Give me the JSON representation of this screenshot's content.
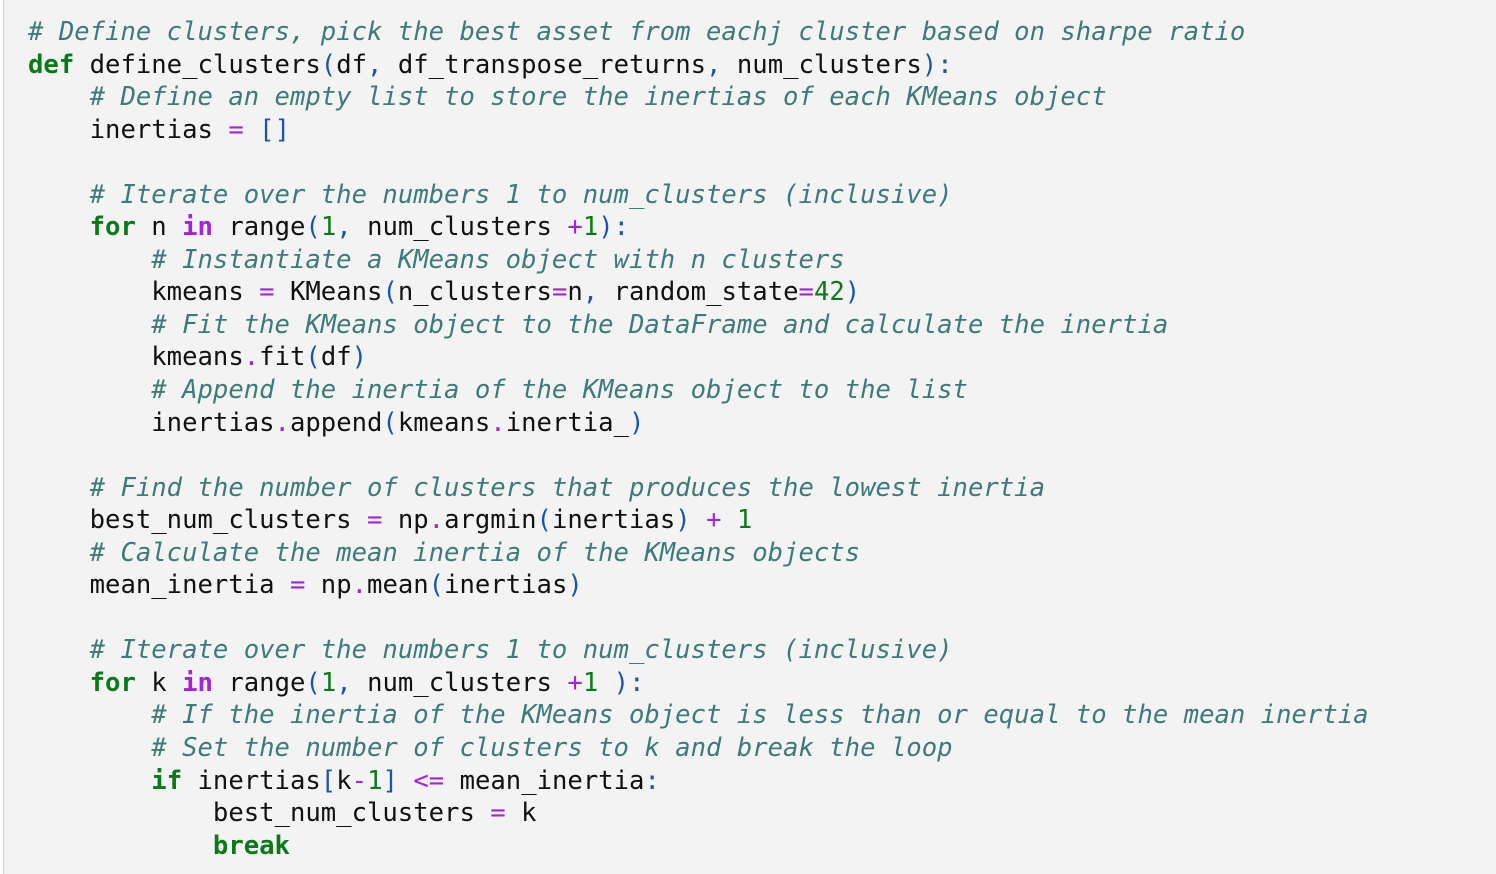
{
  "code_cell": {
    "language": "python",
    "colors": {
      "background": "#f3f3f3",
      "comment": "#3d7a7a",
      "keyword": "#0a7a18",
      "operator": "#a323d6",
      "punctuation": "#1a55a8",
      "number": "#0a7a18",
      "text": "#111111"
    },
    "lines": [
      [
        [
          "comment",
          "# Define clusters, pick the best asset from eachj cluster based on sharpe ratio"
        ]
      ],
      [
        [
          "keyword",
          "def"
        ],
        [
          "name",
          " define_clusters"
        ],
        [
          "punc",
          "("
        ],
        [
          "name",
          "df"
        ],
        [
          "punc",
          ","
        ],
        [
          "name",
          " df_transpose_returns"
        ],
        [
          "punc",
          ","
        ],
        [
          "name",
          " num_clusters"
        ],
        [
          "punc",
          "):"
        ]
      ],
      [
        [
          "name",
          "    "
        ],
        [
          "comment",
          "# Define an empty list to store the inertias of each KMeans object"
        ]
      ],
      [
        [
          "name",
          "    inertias "
        ],
        [
          "op",
          "="
        ],
        [
          "name",
          " "
        ],
        [
          "punc",
          "[]"
        ]
      ],
      [],
      [
        [
          "name",
          "    "
        ],
        [
          "comment",
          "# Iterate over the numbers 1 to num_clusters (inclusive)"
        ]
      ],
      [
        [
          "name",
          "    "
        ],
        [
          "keyword",
          "for"
        ],
        [
          "name",
          " n "
        ],
        [
          "kwop",
          "in"
        ],
        [
          "name",
          " range"
        ],
        [
          "punc",
          "("
        ],
        [
          "num",
          "1"
        ],
        [
          "punc",
          ","
        ],
        [
          "name",
          " num_clusters "
        ],
        [
          "op",
          "+"
        ],
        [
          "num",
          "1"
        ],
        [
          "punc",
          "):"
        ]
      ],
      [
        [
          "name",
          "        "
        ],
        [
          "comment",
          "# Instantiate a KMeans object with n clusters"
        ]
      ],
      [
        [
          "name",
          "        kmeans "
        ],
        [
          "op",
          "="
        ],
        [
          "name",
          " KMeans"
        ],
        [
          "punc",
          "("
        ],
        [
          "name",
          "n_clusters"
        ],
        [
          "op",
          "="
        ],
        [
          "name",
          "n"
        ],
        [
          "punc",
          ","
        ],
        [
          "name",
          " random_state"
        ],
        [
          "op",
          "="
        ],
        [
          "num",
          "42"
        ],
        [
          "punc",
          ")"
        ]
      ],
      [
        [
          "name",
          "        "
        ],
        [
          "comment",
          "# Fit the KMeans object to the DataFrame and calculate the inertia"
        ]
      ],
      [
        [
          "name",
          "        kmeans"
        ],
        [
          "op",
          "."
        ],
        [
          "name",
          "fit"
        ],
        [
          "punc",
          "("
        ],
        [
          "name",
          "df"
        ],
        [
          "punc",
          ")"
        ]
      ],
      [
        [
          "name",
          "        "
        ],
        [
          "comment",
          "# Append the inertia of the KMeans object to the list"
        ]
      ],
      [
        [
          "name",
          "        inertias"
        ],
        [
          "op",
          "."
        ],
        [
          "name",
          "append"
        ],
        [
          "punc",
          "("
        ],
        [
          "name",
          "kmeans"
        ],
        [
          "op",
          "."
        ],
        [
          "name",
          "inertia_"
        ],
        [
          "punc",
          ")"
        ]
      ],
      [],
      [
        [
          "name",
          "    "
        ],
        [
          "comment",
          "# Find the number of clusters that produces the lowest inertia"
        ]
      ],
      [
        [
          "name",
          "    best_num_clusters "
        ],
        [
          "op",
          "="
        ],
        [
          "name",
          " np"
        ],
        [
          "op",
          "."
        ],
        [
          "name",
          "argmin"
        ],
        [
          "punc",
          "("
        ],
        [
          "name",
          "inertias"
        ],
        [
          "punc",
          ")"
        ],
        [
          "name",
          " "
        ],
        [
          "op",
          "+"
        ],
        [
          "name",
          " "
        ],
        [
          "num",
          "1"
        ]
      ],
      [
        [
          "name",
          "    "
        ],
        [
          "comment",
          "# Calculate the mean inertia of the KMeans objects"
        ]
      ],
      [
        [
          "name",
          "    mean_inertia "
        ],
        [
          "op",
          "="
        ],
        [
          "name",
          " np"
        ],
        [
          "op",
          "."
        ],
        [
          "name",
          "mean"
        ],
        [
          "punc",
          "("
        ],
        [
          "name",
          "inertias"
        ],
        [
          "punc",
          ")"
        ]
      ],
      [],
      [
        [
          "name",
          "    "
        ],
        [
          "comment",
          "# Iterate over the numbers 1 to num_clusters (inclusive)"
        ]
      ],
      [
        [
          "name",
          "    "
        ],
        [
          "keyword",
          "for"
        ],
        [
          "name",
          " k "
        ],
        [
          "kwop",
          "in"
        ],
        [
          "name",
          " range"
        ],
        [
          "punc",
          "("
        ],
        [
          "num",
          "1"
        ],
        [
          "punc",
          ","
        ],
        [
          "name",
          " num_clusters "
        ],
        [
          "op",
          "+"
        ],
        [
          "num",
          "1"
        ],
        [
          "name",
          " "
        ],
        [
          "punc",
          "):"
        ]
      ],
      [
        [
          "name",
          "        "
        ],
        [
          "comment",
          "# If the inertia of the KMeans object is less than or equal to the mean inertia"
        ]
      ],
      [
        [
          "name",
          "        "
        ],
        [
          "comment",
          "# Set the number of clusters to k and break the loop"
        ]
      ],
      [
        [
          "name",
          "        "
        ],
        [
          "keyword",
          "if"
        ],
        [
          "name",
          " inertias"
        ],
        [
          "punc",
          "["
        ],
        [
          "name",
          "k"
        ],
        [
          "op",
          "-"
        ],
        [
          "num",
          "1"
        ],
        [
          "punc",
          "]"
        ],
        [
          "name",
          " "
        ],
        [
          "op",
          "<="
        ],
        [
          "name",
          " mean_inertia"
        ],
        [
          "punc",
          ":"
        ]
      ],
      [
        [
          "name",
          "            best_num_clusters "
        ],
        [
          "op",
          "="
        ],
        [
          "name",
          " k"
        ]
      ],
      [
        [
          "name",
          "            "
        ],
        [
          "keyword",
          "break"
        ]
      ]
    ]
  }
}
